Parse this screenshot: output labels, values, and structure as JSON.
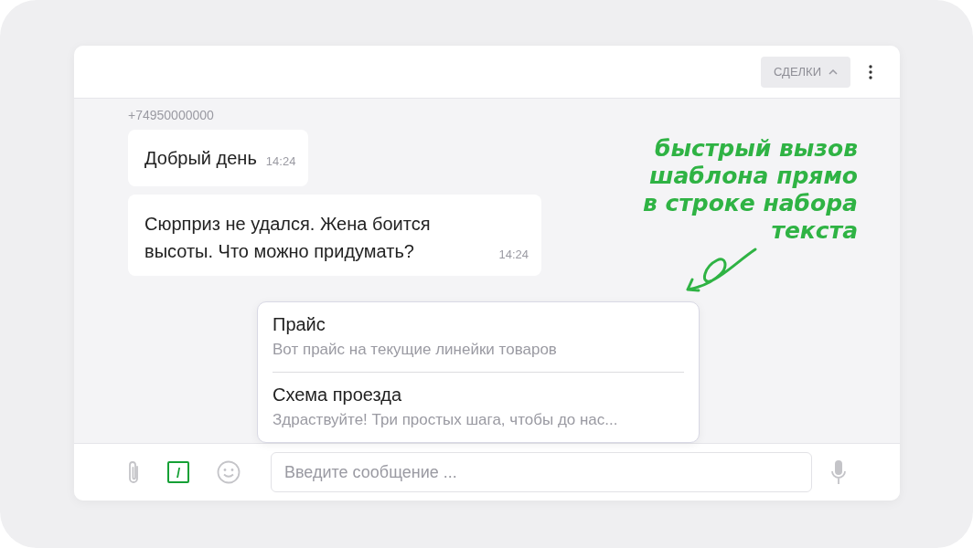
{
  "header": {
    "deals_button": "СДЕЛКИ"
  },
  "chat": {
    "sender": "+74950000000",
    "messages": [
      {
        "text": "Добрый день",
        "time": "14:24"
      },
      {
        "text": "Сюрприз не удался. Жена боится высоты. Что можно придумать?",
        "time": "14:24"
      }
    ]
  },
  "annotation": "быстрый вызов шаблона прямо в строке набора текста",
  "templates": [
    {
      "title": "Прайс",
      "preview": "Вот прайс на текущие линейки товаров"
    },
    {
      "title": "Схема проезда",
      "preview": "Здраствуйте! Три простых шага, чтобы до нас..."
    }
  ],
  "composer": {
    "template_button": {
      "label": "/",
      "selected": true
    },
    "placeholder": "Введите сообщение ..."
  }
}
